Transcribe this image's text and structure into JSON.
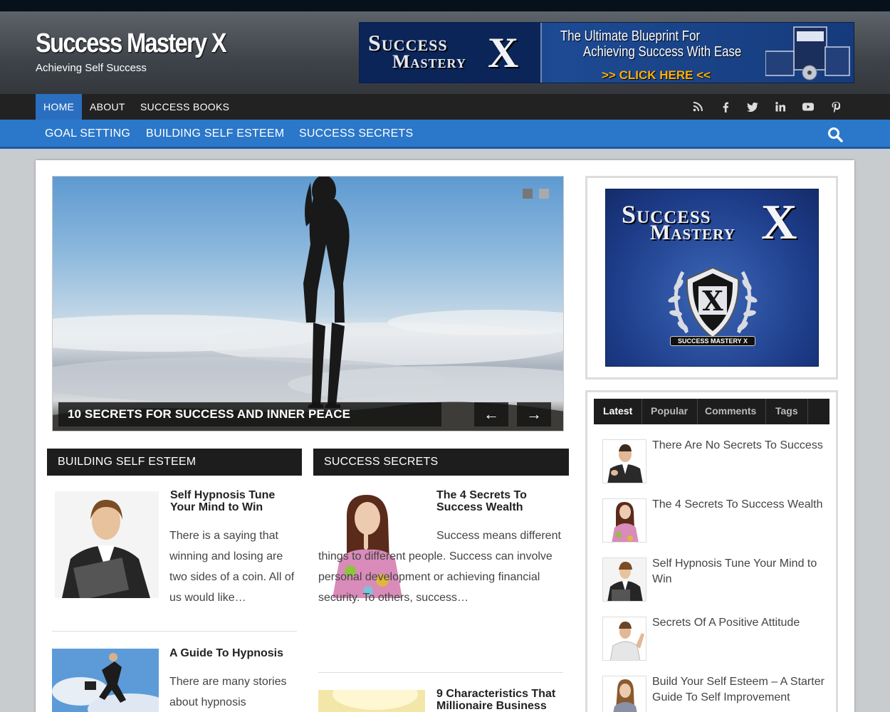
{
  "site": {
    "title": "Success Mastery X",
    "tagline": "Achieving Self Success"
  },
  "banner": {
    "logo_line1": "Success",
    "logo_line2": "Mastery",
    "logo_x": "X",
    "line1": "The Ultimate Blueprint For",
    "line2": "Achieving Success With Ease",
    "cta": ">> CLICK HERE <<"
  },
  "nav_primary": {
    "items": [
      {
        "label": "HOME"
      },
      {
        "label": "ABOUT"
      },
      {
        "label": "SUCCESS BOOKS"
      }
    ]
  },
  "social": [
    "rss-icon",
    "facebook-icon",
    "twitter-icon",
    "linkedin-icon",
    "youtube-icon",
    "pinterest-icon"
  ],
  "nav_secondary": {
    "items": [
      {
        "label": "GOAL SETTING"
      },
      {
        "label": "BUILDING SELF ESTEEM"
      },
      {
        "label": "SUCCESS SECRETS"
      }
    ]
  },
  "slider": {
    "caption": "10 SECRETS FOR SUCCESS AND INNER PEACE",
    "prev": "←",
    "next": "→"
  },
  "sections": [
    {
      "title": "BUILDING SELF ESTEEM",
      "posts": [
        {
          "title": "Self Hypnosis Tune Your Mind to Win",
          "excerpt": "There is a saying that winning and losing are two sides of a coin. All of us would like…"
        },
        {
          "title": "A Guide To Hypnosis",
          "excerpt": "There are many stories about hypnosis"
        }
      ]
    },
    {
      "title": "SUCCESS SECRETS",
      "posts": [
        {
          "title": "The 4 Secrets To Success Wealth",
          "excerpt": "Success means different things to different people. Success can involve personal development or achieving financial security. To others, success…"
        },
        {
          "title": "9 Characteristics That Millionaire Business",
          "excerpt": ""
        }
      ]
    }
  ],
  "sidebar": {
    "ad": {
      "line1": "Success",
      "line2": "Mastery",
      "x": "X",
      "badge": "SUCCESS MASTERY X"
    },
    "tabs": [
      {
        "label": "Latest"
      },
      {
        "label": "Popular"
      },
      {
        "label": "Comments"
      },
      {
        "label": "Tags"
      }
    ],
    "latest": [
      {
        "title": "There Are No Secrets To Success"
      },
      {
        "title": "The 4 Secrets To Success Wealth"
      },
      {
        "title": "Self Hypnosis Tune Your Mind to Win"
      },
      {
        "title": "Secrets Of A Positive Attitude"
      },
      {
        "title": "Build Your Self Esteem – A Starter Guide To Self Improvement"
      }
    ]
  },
  "colors": {
    "accent": "#2b77c9",
    "nav_dark": "#222222",
    "cta": "#ffb000"
  }
}
